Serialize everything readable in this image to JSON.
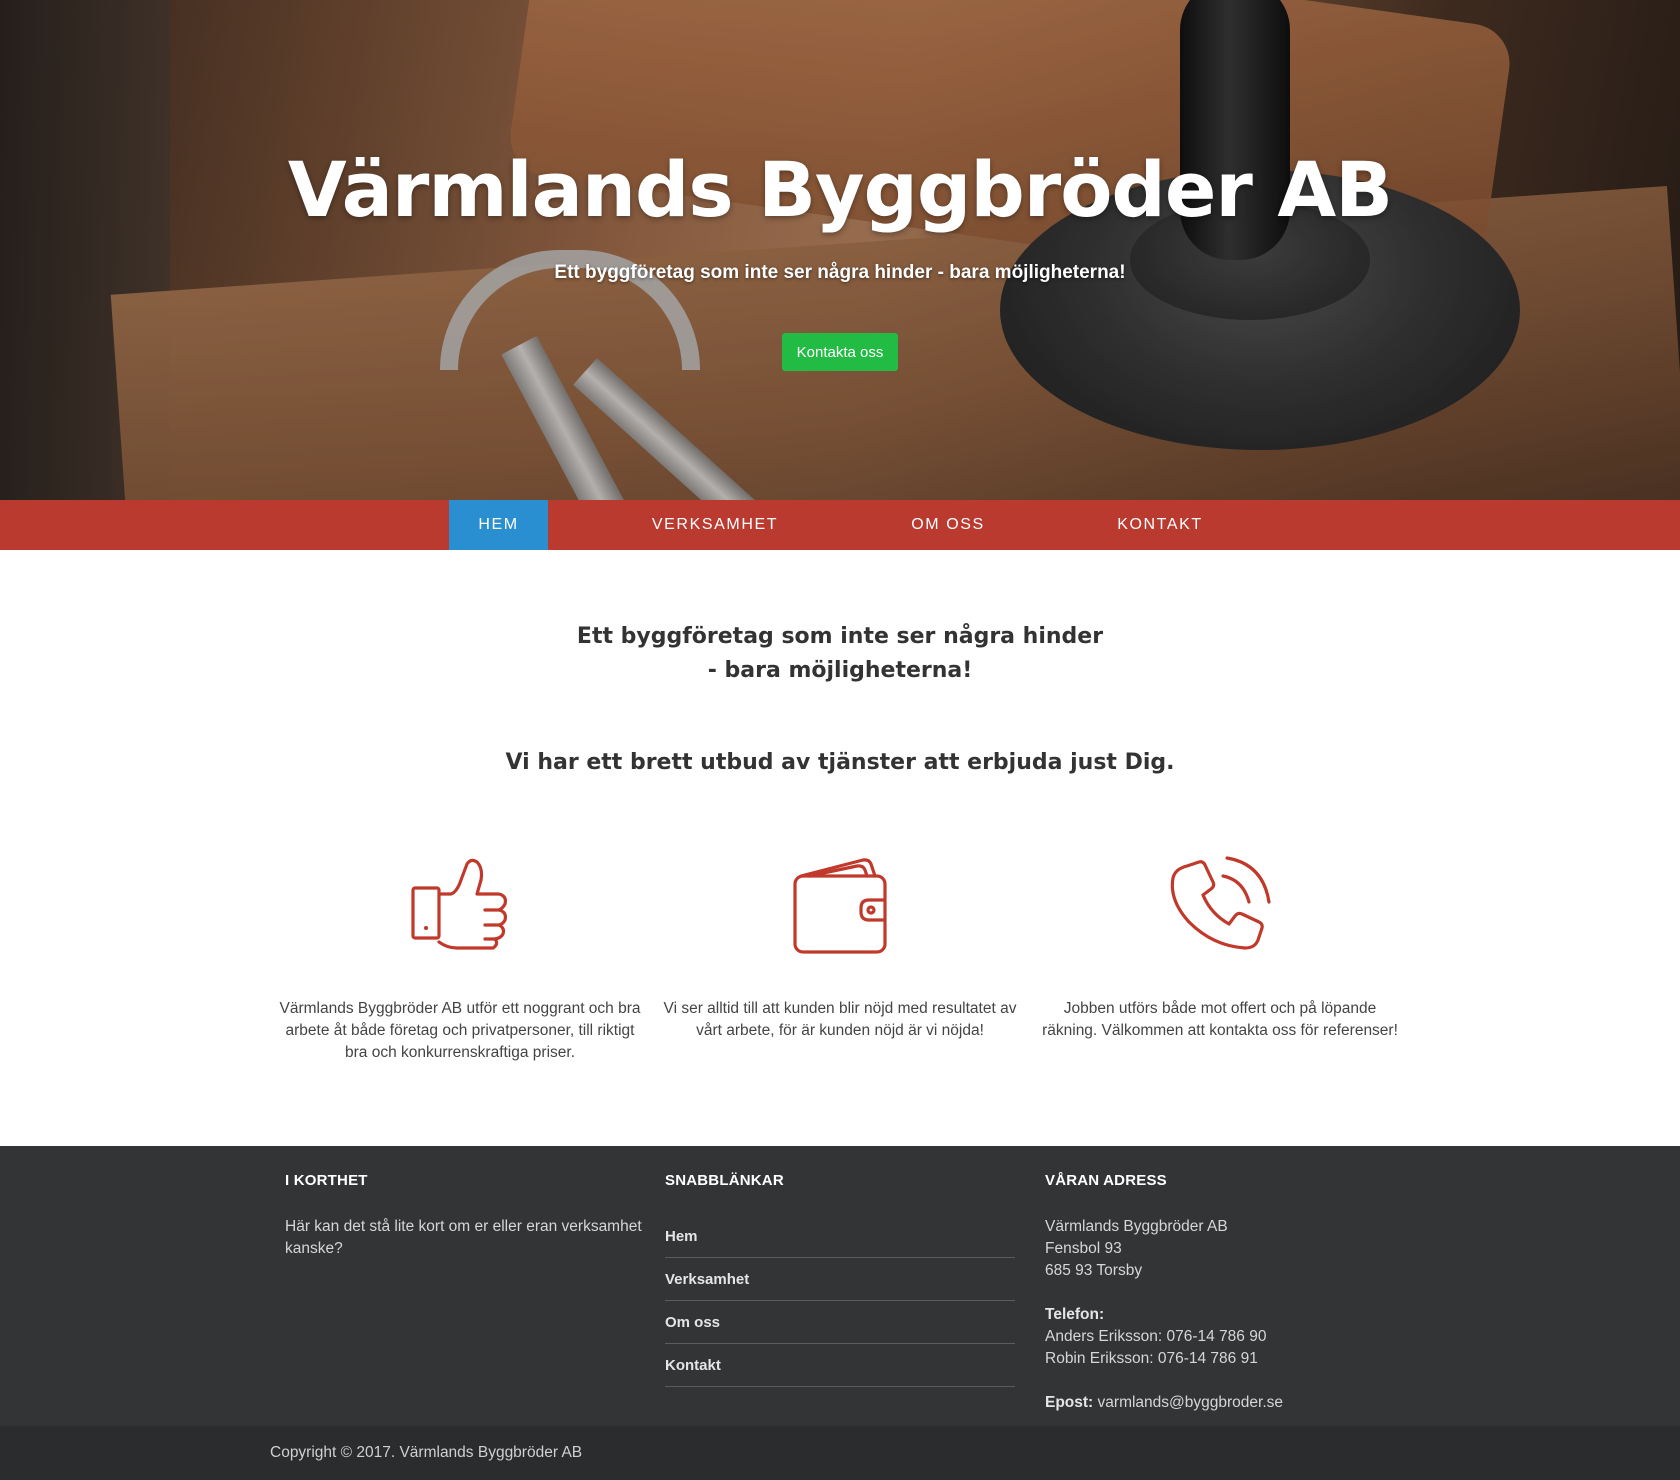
{
  "hero": {
    "title": "Värmlands Byggbröder AB",
    "subtitle": "Ett byggföretag som inte ser några hinder - bara möjligheterna!",
    "button_label": "Kontakta oss",
    "button_color": "#22bb44"
  },
  "nav": {
    "color": "#bb3a2f",
    "active_color": "#2a8fd0",
    "items": [
      {
        "label": "HEM",
        "active": true
      },
      {
        "label": "VERKSAMHET",
        "active": false
      },
      {
        "label": "OM OSS",
        "active": false
      },
      {
        "label": "KONTAKT",
        "active": false
      }
    ]
  },
  "main": {
    "heading_line1": "Ett byggföretag som inte ser några hinder",
    "heading_line2": "- bara möjligheterna!",
    "subheading": "Vi har ett brett utbud av tjänster att erbjuda just Dig.",
    "icon_color": "#c0392b",
    "features": [
      {
        "icon": "thumbs-up-icon",
        "text": "Värmlands Byggbröder AB utför ett noggrant och bra arbete åt både företag och privatpersoner, till riktigt bra och konkurrenskraftiga priser."
      },
      {
        "icon": "wallet-icon",
        "text": "Vi ser alltid till att kunden blir nöjd med resultatet av vårt arbete, för är kunden nöjd är vi nöjda!"
      },
      {
        "icon": "phone-icon",
        "text": "Jobben utförs både mot offert och på löpande räkning. Välkommen att kontakta oss för referenser!"
      }
    ]
  },
  "footer": {
    "about": {
      "title": "I KORTHET",
      "text": "Här kan det stå lite kort om er eller eran verksamhet kanske?"
    },
    "links": {
      "title": "SNABBLÄNKAR",
      "items": [
        "Hem",
        "Verksamhet",
        "Om oss",
        "Kontakt"
      ]
    },
    "address": {
      "title": "VÅRAN ADRESS",
      "company": "Värmlands Byggbröder AB",
      "street": "Fensbol 93",
      "city": "685 93 Torsby",
      "phone_label": "Telefon:",
      "phone1": "Anders Eriksson: 076-14 786 90",
      "phone2": "Robin Eriksson: 076-14 786 91",
      "email_label": "Epost:",
      "email": "varmlands@byggbroder.se"
    },
    "copyright": "Copyright © 2017. Värmlands Byggbröder AB"
  }
}
